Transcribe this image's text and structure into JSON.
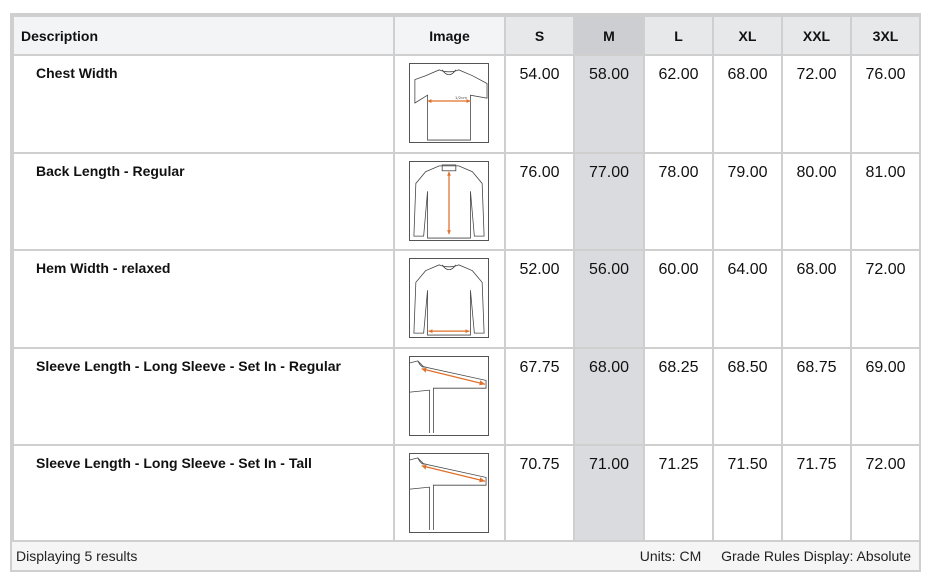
{
  "table": {
    "headers": {
      "description": "Description",
      "image": "Image",
      "sizes": [
        "S",
        "M",
        "L",
        "XL",
        "XXL",
        "3XL"
      ]
    },
    "selected_size": "M",
    "rows": [
      {
        "description": "Chest Width",
        "image_icon": "chest-width-diagram-icon",
        "values": [
          "54.00",
          "58.00",
          "62.00",
          "68.00",
          "72.00",
          "76.00"
        ]
      },
      {
        "description": "Back Length - Regular",
        "image_icon": "back-length-diagram-icon",
        "values": [
          "76.00",
          "77.00",
          "78.00",
          "79.00",
          "80.00",
          "81.00"
        ]
      },
      {
        "description": "Hem Width - relaxed",
        "image_icon": "hem-width-diagram-icon",
        "values": [
          "52.00",
          "56.00",
          "60.00",
          "64.00",
          "68.00",
          "72.00"
        ]
      },
      {
        "description": "Sleeve Length - Long Sleeve - Set In - Regular",
        "image_icon": "sleeve-length-diagram-icon",
        "values": [
          "67.75",
          "68.00",
          "68.25",
          "68.50",
          "68.75",
          "69.00"
        ]
      },
      {
        "description": "Sleeve Length - Long Sleeve - Set In - Tall",
        "image_icon": "sleeve-length-tall-diagram-icon",
        "values": [
          "70.75",
          "71.00",
          "71.25",
          "71.50",
          "71.75",
          "72.00"
        ]
      }
    ]
  },
  "footer": {
    "results": "Displaying 5 results",
    "units": "Units: CM",
    "grade_rules": "Grade Rules Display: Absolute"
  },
  "colors": {
    "header_bg": "#e6e8ea",
    "selected_column": "#d9dbde",
    "border": "#cfcfcf",
    "measure_arrow": "#e0702a"
  }
}
